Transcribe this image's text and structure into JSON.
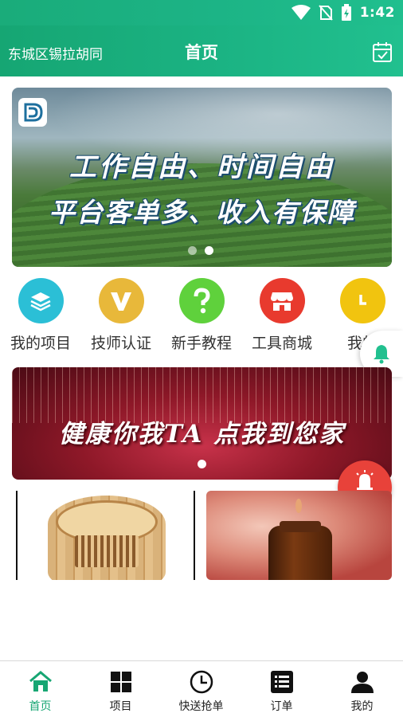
{
  "status_bar": {
    "time": "1:42",
    "icons": [
      "wifi-icon",
      "no-sim-icon",
      "battery-charging-icon"
    ]
  },
  "header": {
    "location": "东城区锡拉胡同",
    "title": "首页",
    "action_icon": "calendar-check-icon"
  },
  "banner": {
    "line1": "工作自由、时间自由",
    "line2": "平台客单多、收入有保障",
    "slides": 2,
    "active_slide": 2
  },
  "categories": [
    {
      "label": "我的项目",
      "icon": "layers-icon",
      "color": "#2bbfd6"
    },
    {
      "label": "技师认证",
      "icon": "v-badge-icon",
      "color": "#e8b83a"
    },
    {
      "label": "新手教程",
      "icon": "question-icon",
      "color": "#5fd13c"
    },
    {
      "label": "工具商城",
      "icon": "shop-icon",
      "color": "#e83a2e"
    },
    {
      "label": "我的",
      "icon": "clock-icon",
      "color": "#f1c40f"
    }
  ],
  "promo": {
    "text": "健康你我TA 点我到您家",
    "slides": 1
  },
  "alarm": {
    "label": "报警"
  },
  "tabs": [
    {
      "label": "首页",
      "icon": "home-icon",
      "active": true
    },
    {
      "label": "项目",
      "icon": "grid-icon",
      "active": false
    },
    {
      "label": "快送抢单",
      "icon": "clock-icon",
      "active": false
    },
    {
      "label": "订单",
      "icon": "list-icon",
      "active": false
    },
    {
      "label": "我的",
      "icon": "user-icon",
      "active": false
    }
  ],
  "colors": {
    "primary": "#1bb383",
    "alarm": "#e8423a"
  }
}
